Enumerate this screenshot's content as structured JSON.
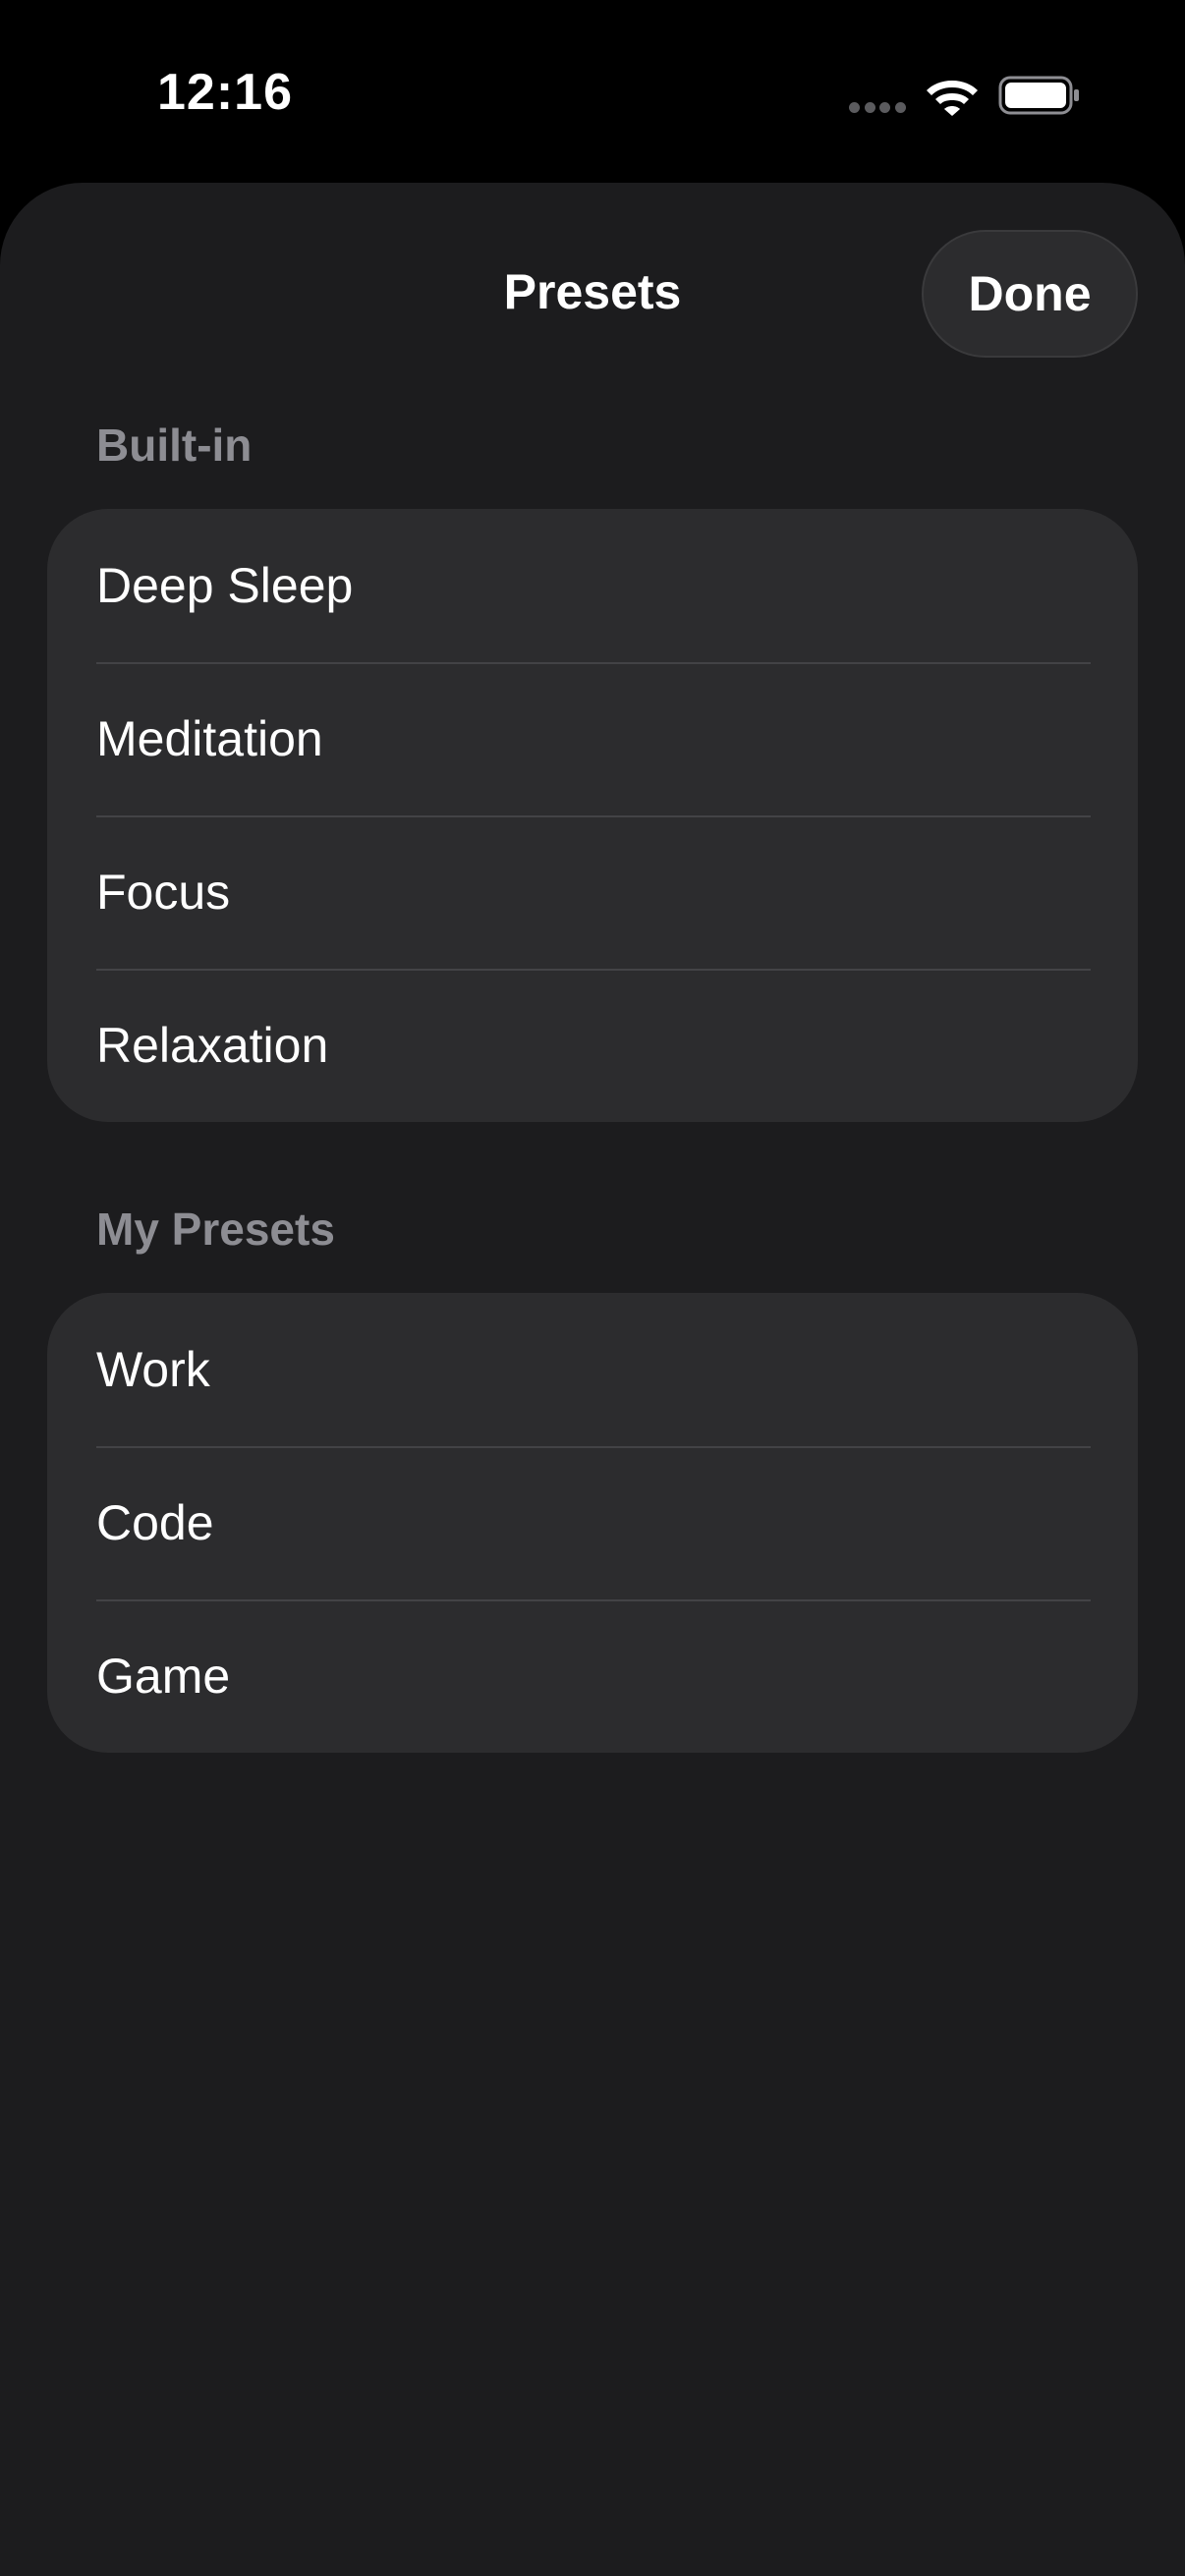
{
  "status_bar": {
    "time": "12:16",
    "icons": [
      "cellular-icon",
      "wifi-icon",
      "battery-icon"
    ]
  },
  "sheet": {
    "title": "Presets",
    "done_label": "Done"
  },
  "sections": [
    {
      "header": "Built-in",
      "items": [
        {
          "label": "Deep Sleep"
        },
        {
          "label": "Meditation"
        },
        {
          "label": "Focus"
        },
        {
          "label": "Relaxation"
        }
      ]
    },
    {
      "header": "My Presets",
      "items": [
        {
          "label": "Work"
        },
        {
          "label": "Code"
        },
        {
          "label": "Game"
        }
      ]
    }
  ],
  "colors": {
    "background": "#000000",
    "sheet": "#1c1c1e",
    "cell": "#2c2c2e",
    "separator": "#434346",
    "section_header": "#8d8d93",
    "text": "#ffffff"
  }
}
